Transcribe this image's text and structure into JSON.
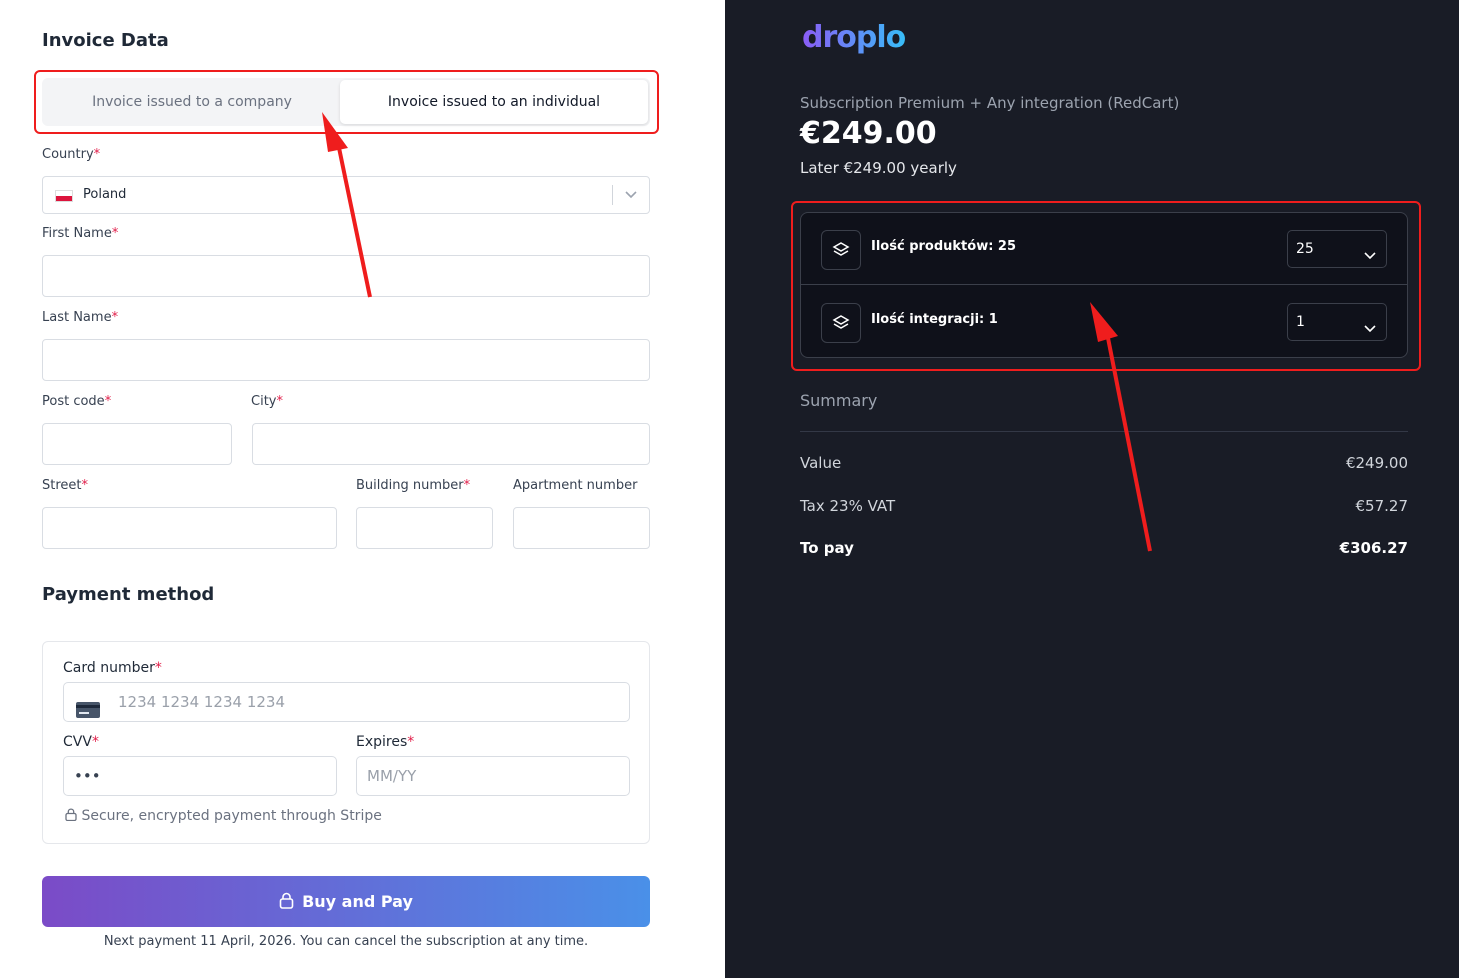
{
  "invoice": {
    "title": "Invoice Data",
    "options": [
      "Invoice issued to a company",
      "Invoice issued to an individual"
    ],
    "selected_option": "Invoice issued to an individual",
    "country_label": "Country",
    "country_value": "Poland",
    "first_name_label": "First Name",
    "last_name_label": "Last Name",
    "post_code_label": "Post code",
    "city_label": "City",
    "street_label": "Street",
    "building_label": "Building number",
    "apartment_label": "Apartment number",
    "required_mark": "*"
  },
  "payment": {
    "title": "Payment method",
    "card_number_label": "Card number",
    "card_number_placeholder": "1234 1234 1234 1234",
    "cvv_label": "CVV",
    "cvv_value": "•••",
    "expires_label": "Expires",
    "expires_placeholder": "MM/YY",
    "secure_note": "Secure, encrypted payment through Stripe",
    "button_label": "Buy and Pay",
    "footnote": "Next payment 11 April, 2026. You can cancel the subscription at any time."
  },
  "order": {
    "brand": "droplo",
    "subscription": "Subscription Premium + Any integration (RedCart)",
    "price": "€249.00",
    "later": "Later €249.00 yearly",
    "options": [
      {
        "label": "Ilość produktów: 25",
        "value": "25"
      },
      {
        "label": "Ilość integracji: 1",
        "value": "1"
      }
    ],
    "summary_title": "Summary",
    "rows": [
      {
        "label": "Value",
        "value": "€249.00"
      },
      {
        "label": "Tax 23% VAT",
        "value": "€57.27"
      },
      {
        "label": "To pay",
        "value": "€306.27"
      }
    ]
  },
  "icons": [
    "poland-flag-icon",
    "chevron-down-icon",
    "credit-card-icon",
    "lock-icon",
    "layers-icon"
  ],
  "colors": {
    "accent_red": "#ef1d1d",
    "dark_panel": "#191c26",
    "button_start": "#7b4bc7",
    "button_end": "#4a90e8",
    "required": "#e11d48"
  }
}
